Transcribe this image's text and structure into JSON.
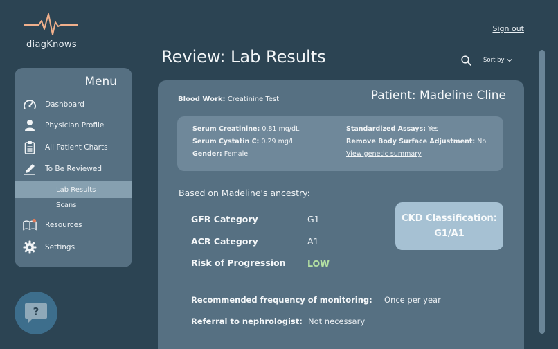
{
  "brand": {
    "name": "diagKnows",
    "accent": "#f0b08c"
  },
  "header": {
    "signout_label": "Sign out",
    "page_title": "Review: Lab Results",
    "sort_label": "Sort by"
  },
  "sidebar": {
    "title": "Menu",
    "items": [
      {
        "label": "Dashboard",
        "icon": "gauge-icon"
      },
      {
        "label": "Physician Profile",
        "icon": "person-icon"
      },
      {
        "label": "All Patient Charts",
        "icon": "clipboard-icon"
      },
      {
        "label": "To Be Reviewed",
        "icon": "pencil-icon"
      }
    ],
    "sub_items": [
      {
        "label": "Lab Results",
        "active": true
      },
      {
        "label": "Scans",
        "active": false
      }
    ],
    "bottom_items": [
      {
        "label": "Resources",
        "icon": "book-icon"
      },
      {
        "label": "Settings",
        "icon": "gear-icon"
      }
    ]
  },
  "help": {
    "symbol": "?"
  },
  "card": {
    "bloodwork_label": "Blood Work:",
    "bloodwork_value": "Creatinine Test",
    "patient_label": "Patient:",
    "patient_name": "Madeline Cline",
    "info": {
      "serum_creatinine_label": "Serum Creatinine:",
      "serum_creatinine_value": "0.81 mg/dL",
      "serum_cystatin_label": "Serum Cystatin C:",
      "serum_cystatin_value": "0.29 mg/L",
      "gender_label": "Gender:",
      "gender_value": "Female",
      "assays_label": "Standardized Assays:",
      "assays_value": "Yes",
      "bsa_label": "Remove Body Surface Adjustment:",
      "bsa_value": "No",
      "genetic_link": "View genetic summary"
    },
    "ancestry_prefix": "Based on",
    "ancestry_name": "Madeline's",
    "ancestry_suffix": "ancestry:",
    "metrics": [
      {
        "label": "GFR Category",
        "value": "G1"
      },
      {
        "label": "ACR Category",
        "value": "A1"
      },
      {
        "label": "Risk of Progression",
        "value": "LOW"
      }
    ],
    "ckd_line1": "CKD Classification:",
    "ckd_line2": "G1/A1",
    "monitoring_label": "Recommended frequency of monitoring:",
    "monitoring_value": "Once per year",
    "referral_label": "Referral to nephrologist:",
    "referral_value": "Not necessary"
  }
}
